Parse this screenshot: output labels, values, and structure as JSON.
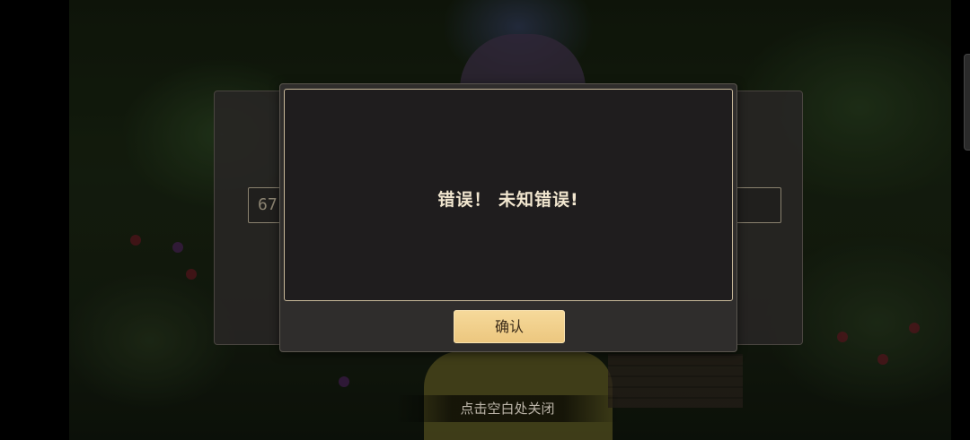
{
  "background_panel": {
    "title": "",
    "input_value": "67"
  },
  "dialog": {
    "message": "错误！ 未知错误!",
    "confirm_label": "确认"
  },
  "hint": {
    "tap_to_close": "点击空白处关闭"
  },
  "colors": {
    "dialog_border": "#c9b99a",
    "button_fill": "#f0cf8b",
    "message_text": "#f1e6cf"
  }
}
